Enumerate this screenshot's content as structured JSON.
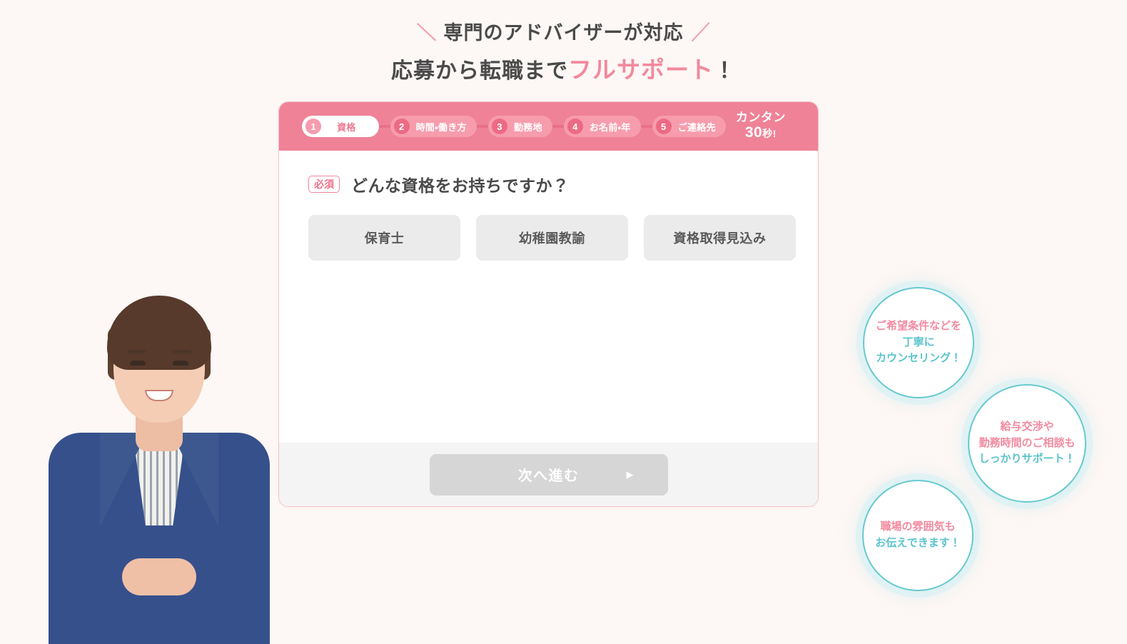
{
  "headline": {
    "line1": "専門のアドバイザーが対応",
    "slash_left": "＼",
    "slash_right": "／",
    "line2_prefix": "応募から転職まで",
    "line2_accent": "フルサポート",
    "line2_suffix": "！"
  },
  "accent_colors": {
    "pink": "#ef8297",
    "pink_dark": "#ec6a84",
    "pink_light": "#f79cad",
    "teal": "#5cc4cb",
    "text_dark": "#4a4a4a",
    "option_bg": "#ebebeb",
    "footer_bg": "#f4f4f4",
    "disabled_button": "#d6d6d6",
    "page_bg": "#fdf7f5"
  },
  "stepbar": {
    "steps": [
      {
        "number": "1",
        "label": "資格",
        "active": true
      },
      {
        "number": "2",
        "label": "時間・働き方",
        "active": false
      },
      {
        "number": "3",
        "label": "勤務地",
        "active": false
      },
      {
        "number": "4",
        "label": "お名前・年",
        "active": false
      },
      {
        "number": "5",
        "label": "ご連絡先",
        "active": false
      }
    ],
    "quick_note_line1": "カンタン",
    "quick_note_number": "30",
    "quick_note_unit": "秒!"
  },
  "question": {
    "required_badge": "必須",
    "text": "どんな資格をお持ちですか？",
    "options": [
      {
        "label": "保育士"
      },
      {
        "label": "幼稚園教諭"
      },
      {
        "label": "資格取得見込み"
      }
    ]
  },
  "footer": {
    "next_label": "次へ進む",
    "next_arrow": "▶",
    "next_disabled": true
  },
  "bubbles": [
    {
      "id": "counseling",
      "lines": [
        {
          "text": "ご希望条件などを",
          "color": "pink"
        },
        {
          "text": "丁寧に",
          "color": "teal"
        },
        {
          "text": "カウンセリング！",
          "color": "teal"
        }
      ]
    },
    {
      "id": "salary-support",
      "lines": [
        {
          "text": "給与交渉や",
          "color": "pink"
        },
        {
          "text": "勤務時間のご相談も",
          "color": "pink"
        },
        {
          "text": "しっかりサポート！",
          "color": "teal"
        }
      ]
    },
    {
      "id": "workplace-atmosphere",
      "lines": [
        {
          "text": "職場の雰囲気も",
          "color": "pink"
        },
        {
          "text": "お伝えできます！",
          "color": "teal"
        }
      ]
    }
  ],
  "advisor": {
    "alt": "スーツ姿の女性アドバイザー"
  }
}
